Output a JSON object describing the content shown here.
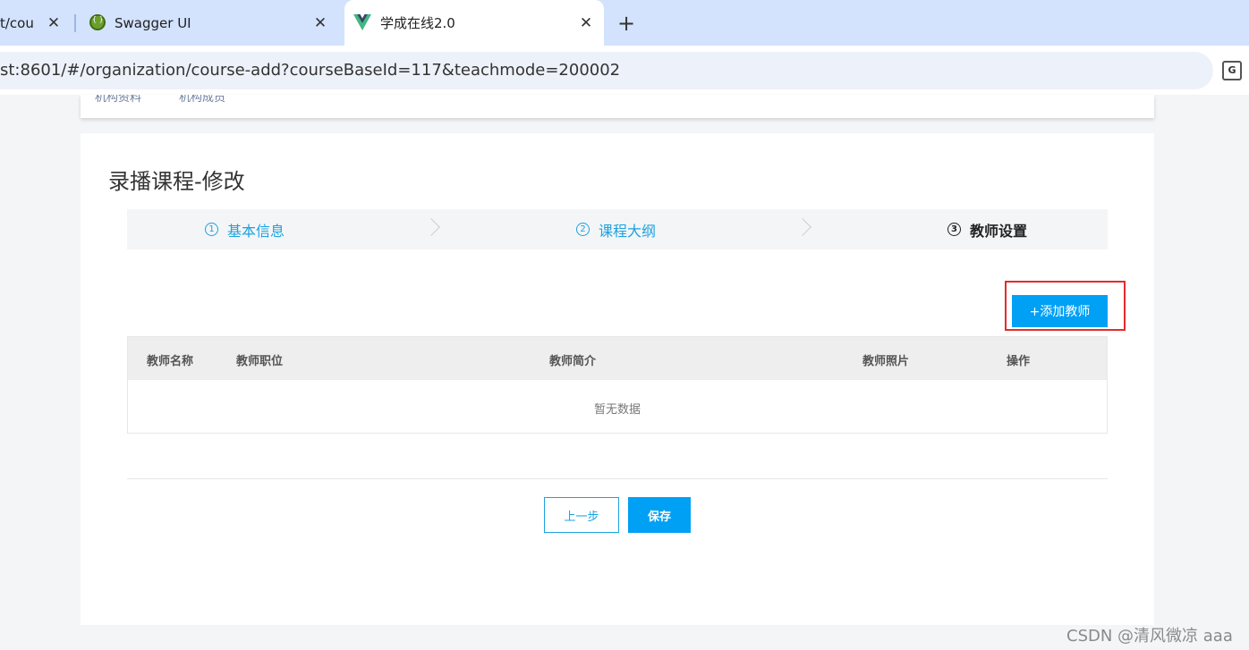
{
  "browser": {
    "tabs": [
      {
        "title": "t/cou"
      },
      {
        "title": "Swagger UI"
      },
      {
        "title": "学成在线2.0"
      }
    ],
    "close_glyph": "✕",
    "new_tab_glyph": "+",
    "url": "st:8601/#/organization/course-add?courseBaseId=117&teachmode=200002",
    "translate_glyph": "G"
  },
  "topcard": {
    "items": [
      "机构资料",
      "机构成员"
    ]
  },
  "page": {
    "title": "录播课程-修改",
    "steps": [
      {
        "num": "1",
        "label": "基本信息"
      },
      {
        "num": "2",
        "label": "课程大纲"
      },
      {
        "num": "3",
        "label": "教师设置"
      }
    ],
    "add_button": "+添加教师",
    "table": {
      "columns": [
        "教师名称",
        "教师职位",
        "教师简介",
        "教师照片",
        "操作"
      ],
      "empty_text": "暂无数据"
    },
    "prev_button": "上一步",
    "save_button": "保存"
  },
  "watermark": "CSDN @清风微凉 aaa",
  "colors": {
    "accent": "#00a0f5",
    "highlight": "#e52b2b"
  }
}
